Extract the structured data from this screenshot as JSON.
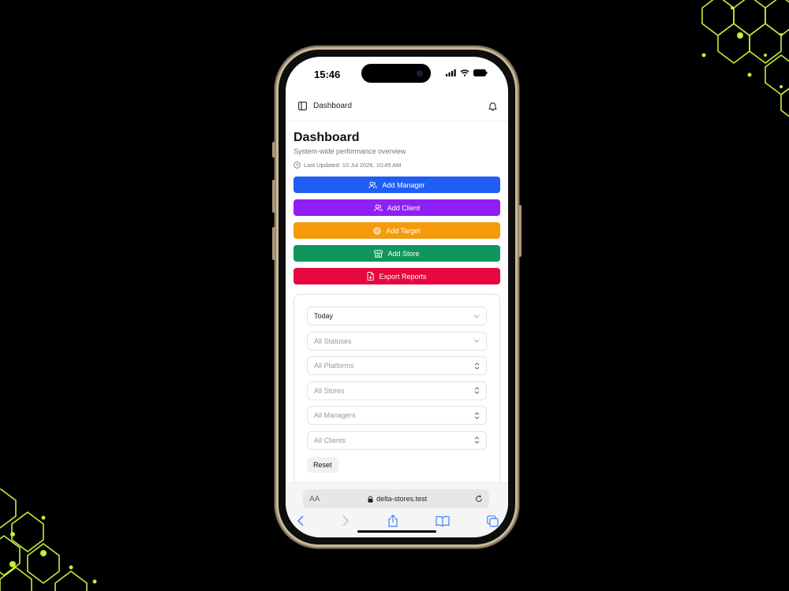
{
  "status_bar": {
    "time": "15:46"
  },
  "top_nav": {
    "breadcrumb": "Dashboard"
  },
  "header": {
    "title": "Dashboard",
    "subtitle": "System-wide performance overview",
    "last_updated": "Last Updated: 10 Jul 2026, 10:45 AM"
  },
  "actions": [
    {
      "label": "Add Manager",
      "color": "#1f5ef5",
      "icon": "users-icon"
    },
    {
      "label": "Add Client",
      "color": "#8f1ff5",
      "icon": "users-icon"
    },
    {
      "label": "Add Target",
      "color": "#f59a0b",
      "icon": "target-icon"
    },
    {
      "label": "Add Store",
      "color": "#10955f",
      "icon": "store-icon"
    },
    {
      "label": "Export Reports",
      "color": "#e6083f",
      "icon": "file-export-icon"
    }
  ],
  "filters": {
    "date_range": "Today",
    "status": "All Statuses",
    "platform": "All Platforms",
    "store": "All Stores",
    "manager": "All Managers",
    "client": "All Clients",
    "reset_label": "Reset"
  },
  "browser": {
    "text_size_label": "AA",
    "url": "delta-stores.test"
  },
  "colors": {
    "accent_green": "#c8ff3c"
  }
}
